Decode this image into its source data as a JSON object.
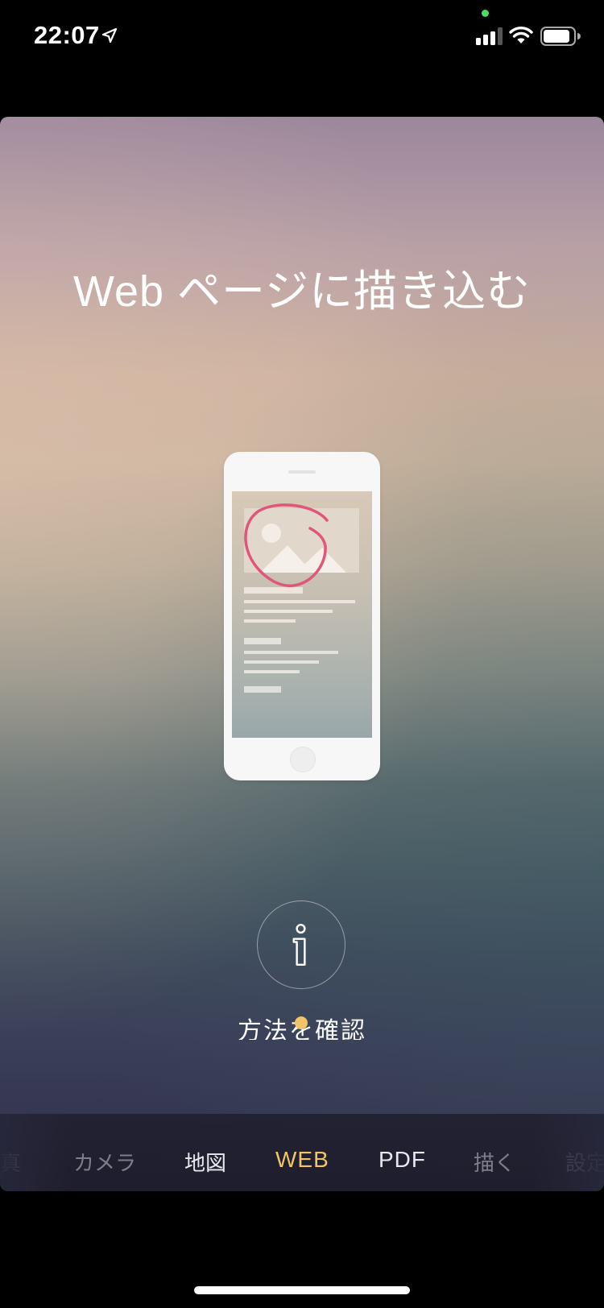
{
  "status_bar": {
    "time": "22:07",
    "icons": [
      "location-arrow-icon",
      "camera-indicator-dot",
      "cellular-signal-icon",
      "wifi-icon",
      "battery-icon"
    ],
    "camera_indicator_color": "#4cd964"
  },
  "main": {
    "title": "Web ページに描き込む",
    "illustration": "phone-with-annotated-webpage",
    "info_button": {
      "icon": "info-icon",
      "label": "方法を確認"
    }
  },
  "tab_bar": {
    "active_color": "#f2c46a",
    "items": [
      {
        "label": "真",
        "state": "partial"
      },
      {
        "label": "カメラ",
        "state": "dim"
      },
      {
        "label": "地図",
        "state": "normal"
      },
      {
        "label": "WEB",
        "state": "active"
      },
      {
        "label": "PDF",
        "state": "normal"
      },
      {
        "label": "描く",
        "state": "dim"
      },
      {
        "label": "設定",
        "state": "partial"
      }
    ]
  }
}
